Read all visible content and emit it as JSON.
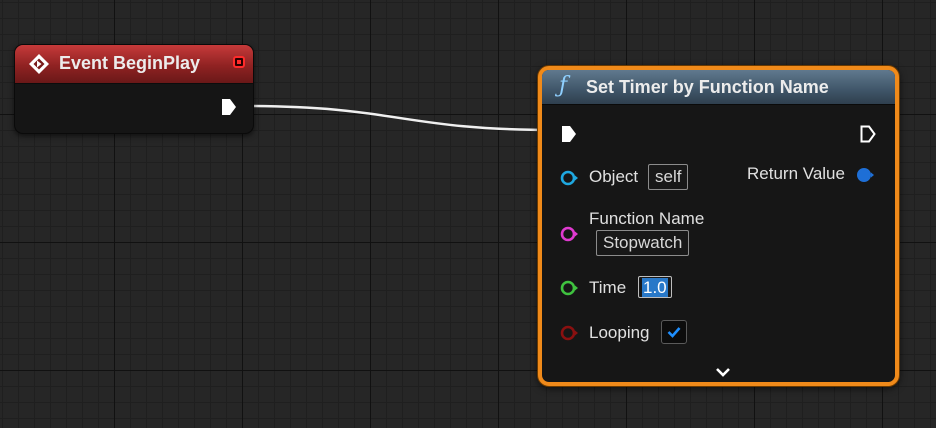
{
  "event_node": {
    "title": "Event BeginPlay",
    "header_color": "#b02c2c"
  },
  "function_node": {
    "function_symbol": "ƒ",
    "title": "Set Timer by Function Name",
    "header_color": "#4b6275",
    "selection_border_color": "#f08a1a",
    "pins": {
      "object": {
        "label": "Object",
        "value": "self",
        "color": "#1fa8e0"
      },
      "return_value": {
        "label": "Return Value",
        "color": "#1e6fd6"
      },
      "function_name": {
        "label": "Function Name",
        "value": "Stopwatch",
        "color": "#e03ad0"
      },
      "time": {
        "label": "Time",
        "value": "1.0",
        "color": "#3fc23f"
      },
      "looping": {
        "label": "Looping",
        "checked": true,
        "color": "#8a1010"
      }
    }
  },
  "exec_wire_color": "#f0f0f0"
}
